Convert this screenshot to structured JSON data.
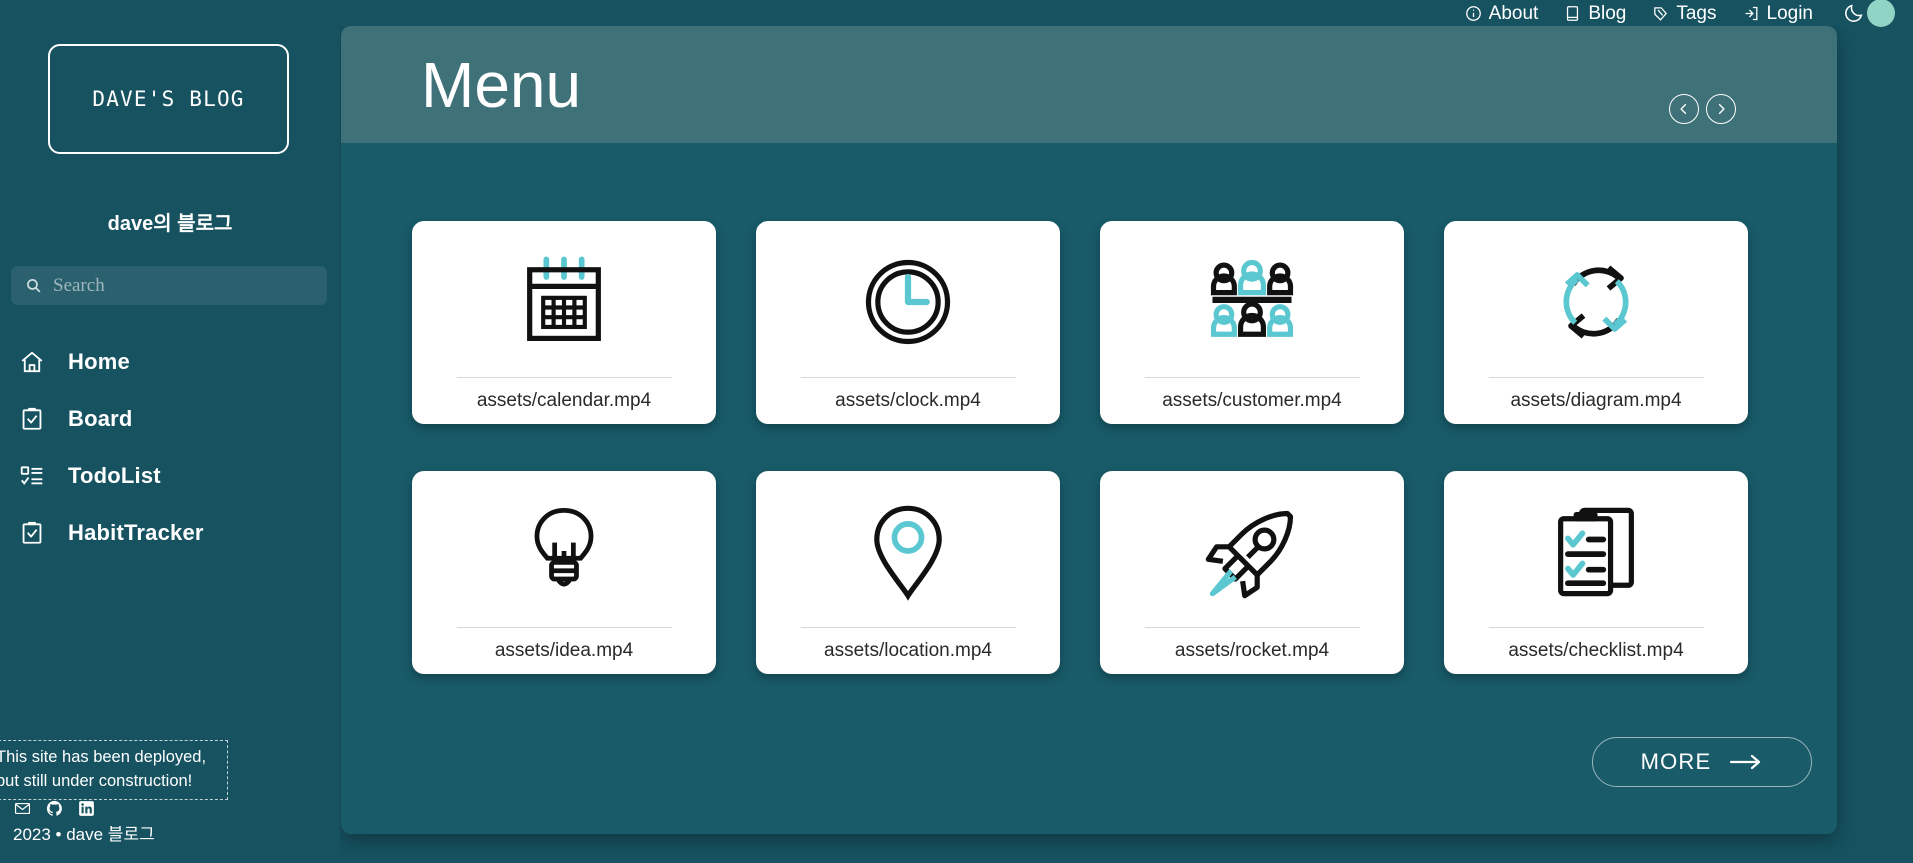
{
  "topnav": {
    "links": [
      {
        "label": "About",
        "icon": "info-circle-icon"
      },
      {
        "label": "Blog",
        "icon": "book-icon"
      },
      {
        "label": "Tags",
        "icon": "tag-icon"
      },
      {
        "label": "Login",
        "icon": "login-icon"
      }
    ],
    "theme_toggle": {
      "icon": "moon-icon",
      "state": "dark"
    }
  },
  "sidebar": {
    "logo": "DAVE'S BLOG",
    "subtitle": "dave의 블로그",
    "search": {
      "placeholder": "Search",
      "value": "",
      "icon": "search-icon"
    },
    "items": [
      {
        "label": "Home",
        "icon": "home-icon"
      },
      {
        "label": "Board",
        "icon": "clipboard-check-icon"
      },
      {
        "label": "TodoList",
        "icon": "list-check-icon"
      },
      {
        "label": "HabitTracker",
        "icon": "clipboard-check-icon"
      }
    ],
    "footer": {
      "notice_line1": "This site has been deployed,",
      "notice_line2": "but still under construction!",
      "socials": [
        {
          "name": "mail-icon"
        },
        {
          "name": "github-icon"
        },
        {
          "name": "linkedin-icon"
        }
      ],
      "copyright": "2023 • dave 블로그"
    }
  },
  "main": {
    "header": {
      "title": "Menu",
      "prev_label": "prev-slide",
      "next_label": "next-slide"
    },
    "cards": [
      {
        "caption": "assets/calendar.mp4",
        "icon": "calendar-icon"
      },
      {
        "caption": "assets/clock.mp4",
        "icon": "clock-icon"
      },
      {
        "caption": "assets/customer.mp4",
        "icon": "customer-icon"
      },
      {
        "caption": "assets/diagram.mp4",
        "icon": "diagram-icon"
      },
      {
        "caption": "assets/idea.mp4",
        "icon": "lightbulb-icon"
      },
      {
        "caption": "assets/location.mp4",
        "icon": "location-pin-icon"
      },
      {
        "caption": "assets/rocket.mp4",
        "icon": "rocket-icon"
      },
      {
        "caption": "assets/checklist.mp4",
        "icon": "checklist-icon"
      }
    ],
    "more_button": {
      "label": "MORE",
      "icon": "arrow-right-icon"
    }
  },
  "colors": {
    "background": "#165260",
    "panel": "#195b69",
    "header_panel": "#3f7179",
    "accent_teal": "#5bc8d1",
    "card_bg": "#ffffff",
    "toggle_knob": "#8fd4c4",
    "text": "#ffffff"
  }
}
